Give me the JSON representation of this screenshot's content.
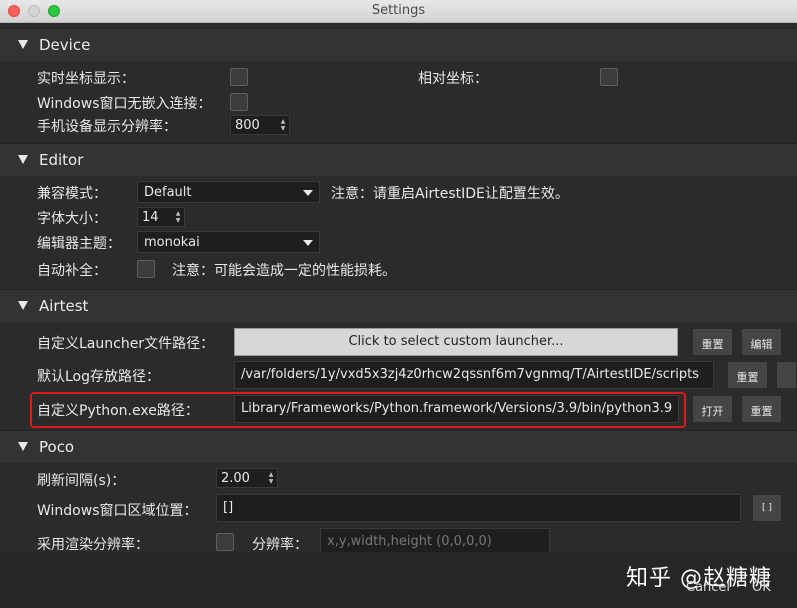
{
  "window": {
    "title": "Settings"
  },
  "device": {
    "header": "Device",
    "realtime_coords_label": "实时坐标显示：",
    "relative_coords_label": "相对坐标：",
    "windows_embed_label": "Windows窗口无嵌入连接：",
    "resolution_label": "手机设备显示分辨率：",
    "resolution_value": "800"
  },
  "editor": {
    "header": "Editor",
    "compat_label": "兼容模式：",
    "compat_value": "Default",
    "compat_note": "注意：请重启AirtestIDE让配置生效。",
    "font_size_label": "字体大小：",
    "font_size_value": "14",
    "theme_label": "编辑器主题：",
    "theme_value": "monokai",
    "autocomplete_label": "自动补全：",
    "autocomplete_note": "注意：可能会造成一定的性能损耗。"
  },
  "airtest": {
    "header": "Airtest",
    "launcher_label": "自定义Launcher文件路径：",
    "launcher_button": "Click to select custom launcher...",
    "reset_label": "重置",
    "edit_label": "编辑",
    "log_label": "默认Log存放路径：",
    "log_value": "/var/folders/1y/vxd5x3zj4z0rhcw2qssnf6m7vgnmq/T/AirtestIDE/scripts",
    "python_label": "自定义Python.exe路径：",
    "python_value": "Library/Frameworks/Python.framework/Versions/3.9/bin/python3.9",
    "open_label": "打开"
  },
  "poco": {
    "header": "Poco",
    "refresh_label": "刷新间隔(s)：",
    "refresh_value": "2.00",
    "win_region_label": "Windows窗口区域位置：",
    "win_region_value": "[]",
    "render_res_label": "采用渲染分辨率：",
    "resolution_label": "分辨率：",
    "resolution_placeholder": "x,y,width,height (0,0,0,0)"
  },
  "footer": {
    "cancel_label": "Cancel",
    "ok_label": "OK",
    "watermark": "知乎 @赵糖糖"
  },
  "colors": {
    "highlight": "#d9191c",
    "background": "#2b2b2b"
  }
}
